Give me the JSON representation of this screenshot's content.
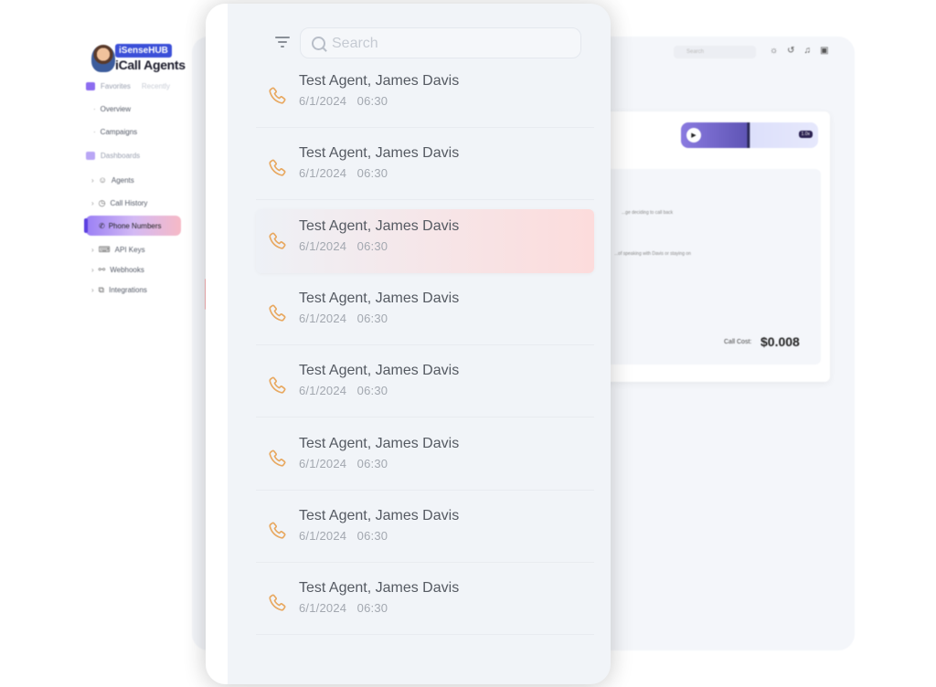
{
  "brand": {
    "tag": "iSenseHUB",
    "name": "iCall Agents"
  },
  "sidebar": {
    "favorites": {
      "label": "Favorites",
      "sub": "Recently"
    },
    "fav_items": [
      "Overview",
      "Campaigns"
    ],
    "dashboards_label": "Dashboards",
    "items": [
      {
        "label": "Agents",
        "icon": "agent-icon"
      },
      {
        "label": "Call History",
        "icon": "history-icon"
      },
      {
        "label": "Phone Numbers",
        "icon": "phone-icon",
        "active": true
      },
      {
        "label": "API Keys",
        "icon": "key-icon"
      },
      {
        "label": "Webhooks",
        "icon": "webhook-icon"
      },
      {
        "label": "Integrations",
        "icon": "integrations-icon"
      }
    ]
  },
  "topbar": {
    "search_placeholder": "Search",
    "icons": [
      "sun-icon",
      "history-icon",
      "bell-icon",
      "panel-icon"
    ]
  },
  "call_detail": {
    "player_speed": "1.0x",
    "transcript_lines": [
      "...ge deciding to call back",
      "...of speaking with Davis or staying on"
    ],
    "cost_label": "Call Cost:",
    "cost_value": "$0.008"
  },
  "modal": {
    "search_placeholder": "Search",
    "calls": [
      {
        "title": "Test Agent, James Davis",
        "date": "6/1/2024",
        "time": "06:30"
      },
      {
        "title": "Test Agent, James Davis",
        "date": "6/1/2024",
        "time": "06:30"
      },
      {
        "title": "Test Agent, James Davis",
        "date": "6/1/2024",
        "time": "06:30",
        "selected": true
      },
      {
        "title": "Test Agent, James Davis",
        "date": "6/1/2024",
        "time": "06:30"
      },
      {
        "title": "Test Agent, James Davis",
        "date": "6/1/2024",
        "time": "06:30"
      },
      {
        "title": "Test Agent, James Davis",
        "date": "6/1/2024",
        "time": "06:30"
      },
      {
        "title": "Test Agent, James Davis",
        "date": "6/1/2024",
        "time": "06:30"
      },
      {
        "title": "Test Agent, James Davis",
        "date": "6/1/2024",
        "time": "06:30"
      }
    ],
    "accent": "#e8a860",
    "selected_tint": "#fcdcdc"
  }
}
